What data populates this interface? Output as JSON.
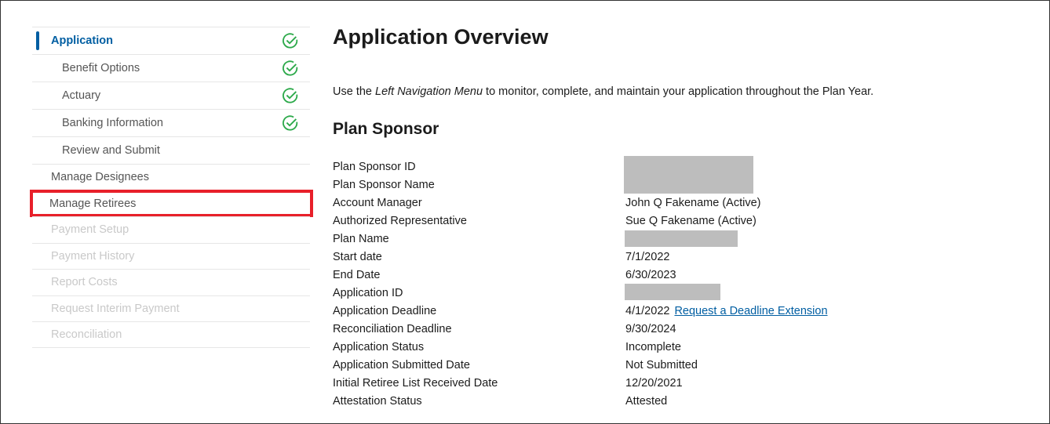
{
  "sidebar": {
    "items": [
      {
        "label": "Application",
        "state": "active",
        "complete": true
      },
      {
        "label": "Benefit Options",
        "complete": true
      },
      {
        "label": "Actuary",
        "complete": true
      },
      {
        "label": "Banking Information",
        "complete": true
      },
      {
        "label": "Review and Submit",
        "complete": false
      },
      {
        "label": "Manage Designees"
      },
      {
        "label": "Manage Retirees",
        "highlighted": true
      },
      {
        "label": "Payment Setup",
        "disabled": true
      },
      {
        "label": "Payment History",
        "disabled": true
      },
      {
        "label": "Report Costs",
        "disabled": true
      },
      {
        "label": "Request Interim Payment",
        "disabled": true
      },
      {
        "label": "Reconciliation",
        "disabled": true
      }
    ]
  },
  "main": {
    "title": "Application Overview",
    "desc_pre": "Use the ",
    "desc_em": "Left Navigation Menu",
    "desc_post": " to monitor, complete, and maintain your application throughout the Plan Year.",
    "section": "Plan Sponsor",
    "details": [
      {
        "label": "Plan Sponsor ID",
        "value": ""
      },
      {
        "label": "Plan Sponsor Name",
        "value": ""
      },
      {
        "label": "Account Manager",
        "value": "John Q Fakename (Active)"
      },
      {
        "label": "Authorized Representative",
        "value": "Sue Q Fakename (Active)"
      },
      {
        "label": "Plan Name",
        "value": ""
      },
      {
        "label": "Start date",
        "value": "7/1/2022"
      },
      {
        "label": "End Date",
        "value": "6/30/2023"
      },
      {
        "label": "Application ID",
        "value": ""
      },
      {
        "label": "Application Deadline",
        "value": "4/1/2022",
        "link": "Request a Deadline Extension"
      },
      {
        "label": "Reconciliation Deadline",
        "value": "9/30/2024"
      },
      {
        "label": "Application Status",
        "value": "Incomplete"
      },
      {
        "label": "Application Submitted Date",
        "value": "Not Submitted"
      },
      {
        "label": "Initial Retiree List Received Date",
        "value": "12/20/2021"
      },
      {
        "label": "Attestation Status",
        "value": "Attested"
      }
    ]
  },
  "colors": {
    "accent": "#005ea2",
    "check": "#2ca94a",
    "highlight": "#e8202a"
  }
}
